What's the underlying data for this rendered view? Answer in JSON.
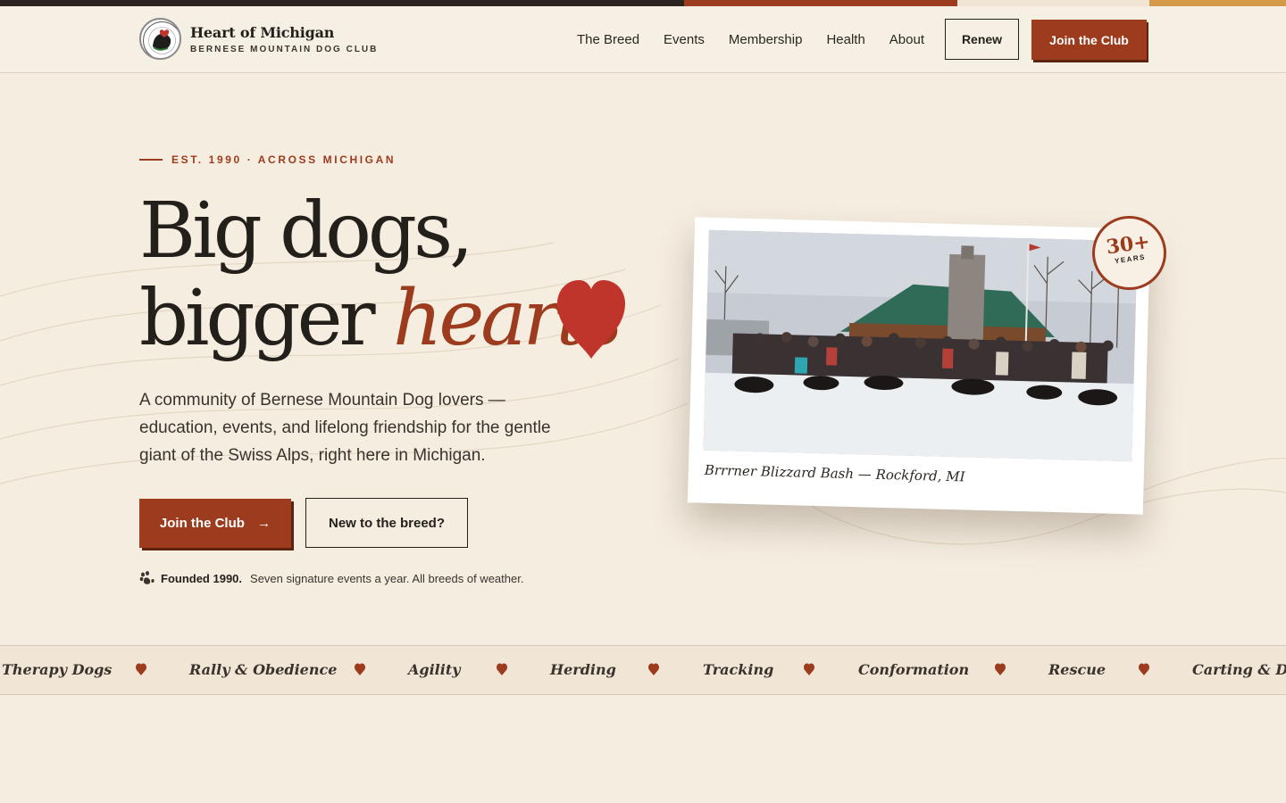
{
  "topbar": {
    "colors": [
      "#2a2320",
      "#9c3b1d",
      "#f0e4d2",
      "#d49a4a"
    ]
  },
  "header": {
    "brand_name": "Heart of Michigan",
    "brand_sub": "BERNESE MOUNTAIN DOG CLUB",
    "nav": [
      "The Breed",
      "Events",
      "Membership",
      "Health",
      "About"
    ],
    "renew_label": "Renew",
    "join_label": "Join the Club"
  },
  "hero": {
    "eyebrow": "EST. 1990 · ACROSS MICHIGAN",
    "headline_line1": "Big dogs,",
    "headline_line2_plain": "bigger ",
    "headline_line2_emphasis": "hearts",
    "lede": "A community of Bernese Mountain Dog lovers — education, events, and lifelong friendship for the gentle giant of the Swiss Alps, right here in Michigan.",
    "primary_cta": "Join the Club",
    "primary_cta_arrow": "→",
    "secondary_cta": "New to the breed?",
    "founded_bold": "Founded 1990.",
    "founded_text": "Seven signature events a year. All breeds of weather."
  },
  "photo": {
    "caption": "Brrrner Blizzard Bash — Rockford, MI"
  },
  "badge": {
    "number": "30+",
    "label": "YEARS"
  },
  "ticker": {
    "items": [
      "Therapy Dogs",
      "Rally & Obedience",
      "Agility",
      "Herding",
      "Tracking",
      "Conformation",
      "Rescue",
      "Carting & Dra"
    ]
  },
  "colors": {
    "accent": "#9c3b1d",
    "heart": "#c0352b",
    "background": "#f5ede0",
    "ink": "#231f1b"
  }
}
